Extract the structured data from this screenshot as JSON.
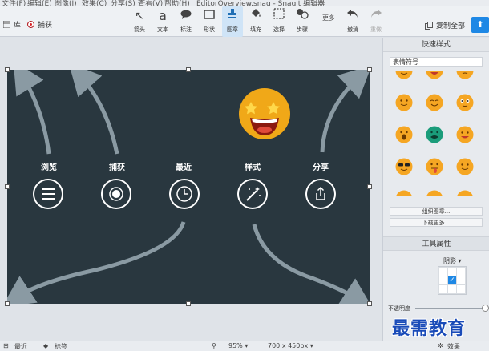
{
  "menubar": {
    "items": [
      "文件(F)",
      "编辑(E)",
      "图像(I)",
      "效果(C)",
      "分享(S)",
      "查看(V)",
      "帮助(H)",
      "EditorOverview.snag - Snagit 编辑器"
    ]
  },
  "toolbar": {
    "library_label": "库",
    "capture_label": "捕获",
    "tools": [
      {
        "label": "箭头",
        "icon": "arrow-icon",
        "glyph": "↖"
      },
      {
        "label": "文本",
        "icon": "text-icon",
        "glyph": "a"
      },
      {
        "label": "标注",
        "icon": "callout-icon",
        "glyph": "💬"
      },
      {
        "label": "形状",
        "icon": "shape-icon",
        "glyph": "▭"
      },
      {
        "label": "图章",
        "icon": "stamp-icon",
        "glyph": "⬆"
      },
      {
        "label": "填充",
        "icon": "fill-icon",
        "glyph": "⬙"
      },
      {
        "label": "选择",
        "icon": "selection-icon",
        "glyph": "⬚"
      },
      {
        "label": "步骤",
        "icon": "step-icon",
        "glyph": "⚙"
      },
      {
        "label": "更多",
        "icon": "more-icon",
        "glyph": ""
      },
      {
        "label": "撤消",
        "icon": "undo-icon",
        "glyph": "↶"
      },
      {
        "label": "重做",
        "icon": "redo-icon",
        "glyph": "↷"
      }
    ],
    "copy_all_label": "复制全部"
  },
  "canvas": {
    "labels": [
      "浏览",
      "捕获",
      "最近",
      "样式",
      "分享"
    ],
    "background": "#29373f"
  },
  "panel": {
    "quick_styles_title": "快速样式",
    "emoji_category": "表情符号",
    "search_button": "组织图章...",
    "download_button": "下载更多...",
    "tool_properties_title": "工具属性",
    "shadow_label": "阴影 ▾",
    "opacity_label": "不透明度"
  },
  "statusbar": {
    "recent_label": "最近",
    "tags_label": "标签",
    "zoom": "95% ▾",
    "dimensions": "700 x 450px ▾",
    "effects_label": "效果"
  },
  "watermark": "最需教育"
}
